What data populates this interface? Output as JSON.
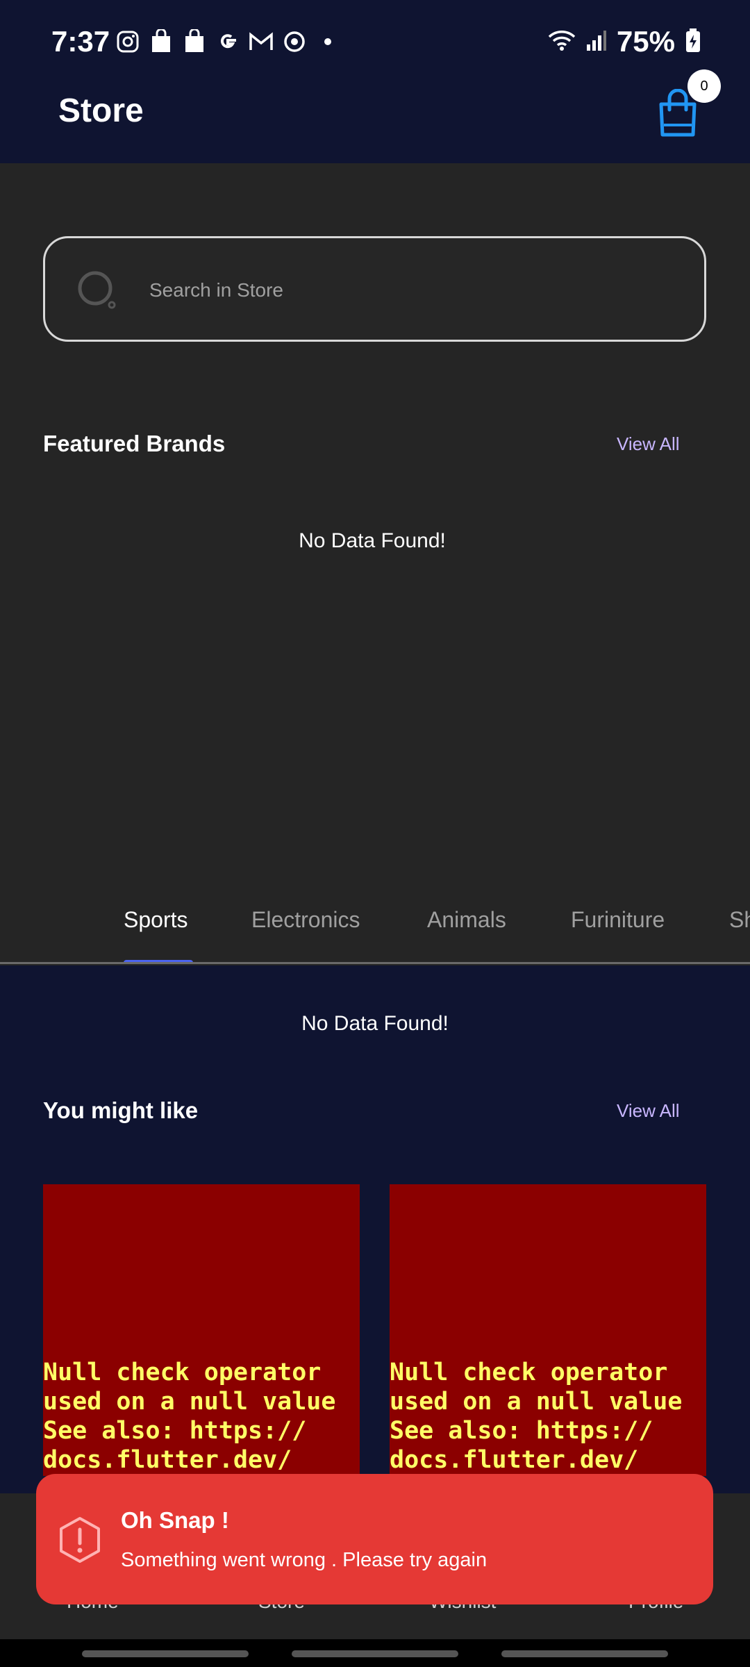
{
  "status_bar": {
    "time": "7:37",
    "battery": "75%"
  },
  "header": {
    "title": "Store",
    "cart_count": "0"
  },
  "search": {
    "placeholder": "Search in Store"
  },
  "featured_brands": {
    "title": "Featured Brands",
    "view_all": "View All",
    "empty_text": "No Data Found!"
  },
  "tabs": [
    {
      "label": "Sports",
      "active": true
    },
    {
      "label": "Electronics",
      "active": false
    },
    {
      "label": "Animals",
      "active": false
    },
    {
      "label": "Furiniture",
      "active": false
    },
    {
      "label": "Sh",
      "active": false
    }
  ],
  "tab_content": {
    "empty_text": "No Data Found!"
  },
  "you_might_like": {
    "title": "You might like",
    "view_all": "View All",
    "cards": [
      {
        "error_text": "Null check operator used on a null value See also: https:// docs.flutter.dev/"
      },
      {
        "error_text": "Null check operator used on a null value See also: https:// docs.flutter.dev/"
      }
    ]
  },
  "bottom_nav": {
    "items": [
      "Home",
      "Store",
      "Wishlist",
      "Profile"
    ]
  },
  "snackbar": {
    "title": "Oh Snap !",
    "message": "Something went wrong . Please try again"
  },
  "colors": {
    "app_bar": "#0f1431",
    "body": "#252525",
    "accent": "#4b63f0",
    "error_card": "#8b0000",
    "snackbar": "#e53935",
    "cart_icon": "#2196f3"
  }
}
